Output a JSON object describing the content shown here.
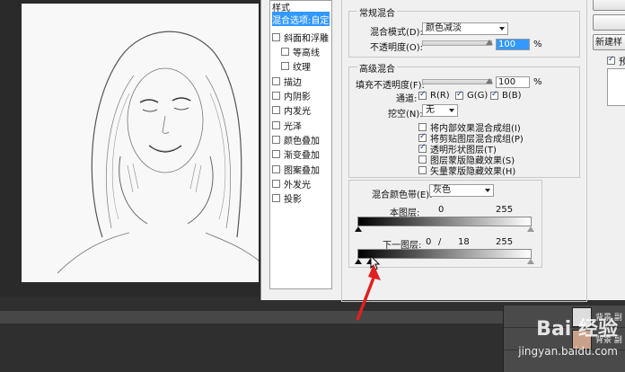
{
  "style_list": {
    "header": "样式",
    "items": [
      {
        "label": "混合选项:自定",
        "checkbox": false,
        "selected": true
      },
      {
        "label": "斜面和浮雕",
        "checkbox": true
      },
      {
        "label": "等高线",
        "checkbox": true,
        "indent": true
      },
      {
        "label": "纹理",
        "checkbox": true,
        "indent": true
      },
      {
        "label": "描边",
        "checkbox": true
      },
      {
        "label": "内阴影",
        "checkbox": true
      },
      {
        "label": "内发光",
        "checkbox": true
      },
      {
        "label": "光泽",
        "checkbox": true
      },
      {
        "label": "颜色叠加",
        "checkbox": true
      },
      {
        "label": "渐变叠加",
        "checkbox": true
      },
      {
        "label": "图案叠加",
        "checkbox": true
      },
      {
        "label": "外发光",
        "checkbox": true
      },
      {
        "label": "投影",
        "checkbox": true
      }
    ]
  },
  "normal_blend": {
    "title": "常规混合",
    "mode_label": "混合模式(D):",
    "mode_value": "颜色减淡",
    "opacity_label": "不透明度(O):",
    "opacity_value": "100",
    "opacity_level": 1.0,
    "percent": "%"
  },
  "advanced_blend": {
    "title": "高级混合",
    "fill_label": "填充不透明度(F):",
    "fill_value": "100",
    "fill_level": 1.0,
    "percent": "%",
    "channels_label": "通道:",
    "channel_r": "R(R)",
    "channel_g": "G(G)",
    "channel_b": "B(B)",
    "knockout_label": "挖空(N):",
    "knockout_value": "无",
    "options": [
      {
        "label": "将内部效果混合成组(I)",
        "checked": false
      },
      {
        "label": "将剪贴图层混合成组(P)",
        "checked": true
      },
      {
        "label": "透明形状图层(T)",
        "checked": true
      },
      {
        "label": "图层蒙版隐藏效果(S)",
        "checked": false
      },
      {
        "label": "矢量蒙版隐藏效果(H)",
        "checked": false
      }
    ]
  },
  "blend_if": {
    "label": "混合颜色带(E):",
    "value": "灰色",
    "this_layer_label": "本图层:",
    "this_layer_low": "0",
    "this_layer_high": "255",
    "underlying_label": "下一图层:",
    "underlying_low": "0",
    "underlying_sep": "/",
    "underlying_split": "18",
    "underlying_high": "255"
  },
  "right_buttons": {
    "new_style": "新建样",
    "preview_label": "预"
  },
  "layers": [
    {
      "name": "背景 副"
    },
    {
      "name": "背景 副"
    }
  ],
  "watermark": {
    "logo": "Bai 经验",
    "url": "jingyan.baidu.com"
  }
}
